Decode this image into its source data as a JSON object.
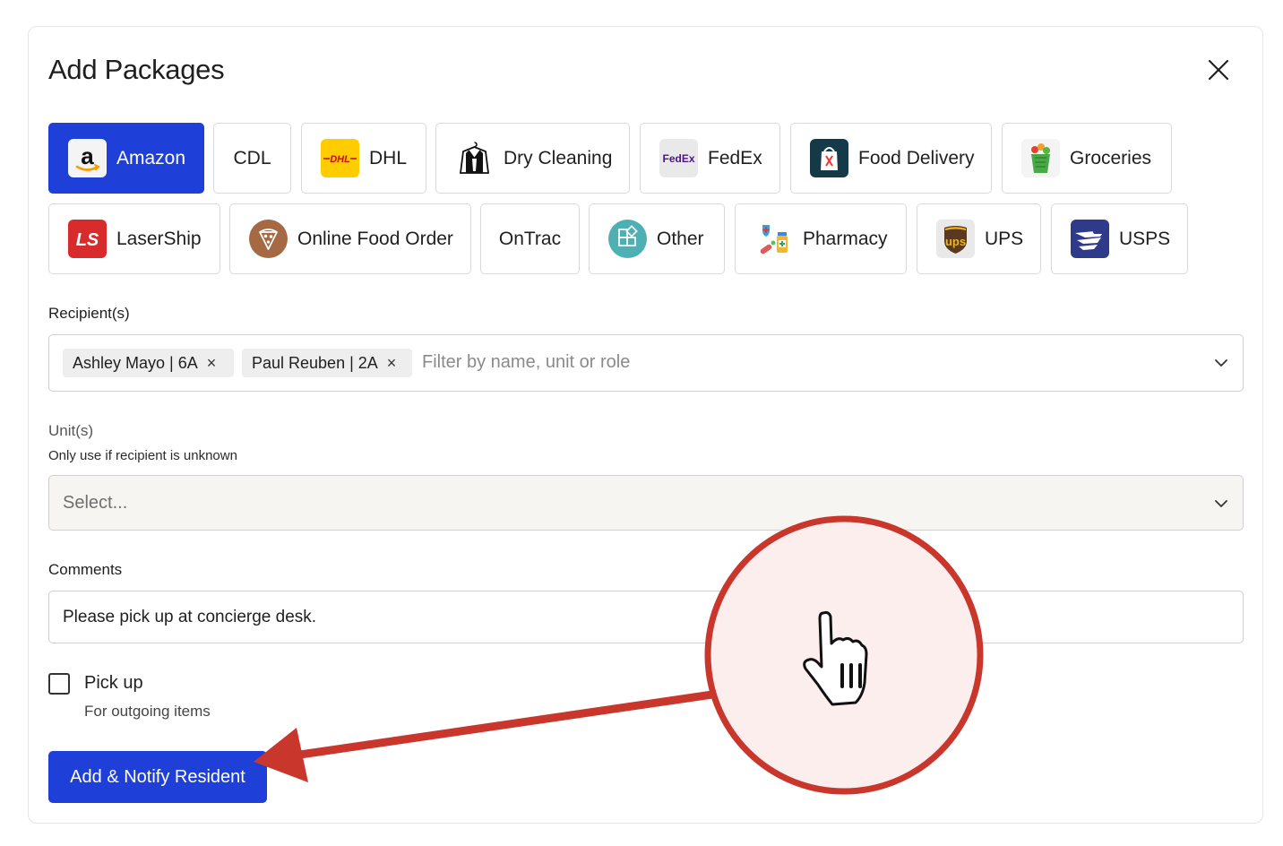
{
  "modal": {
    "title": "Add Packages"
  },
  "carriers": [
    {
      "label": "Amazon",
      "icon": "amazon-icon",
      "selected": true
    },
    {
      "label": "CDL",
      "icon": "",
      "selected": false
    },
    {
      "label": "DHL",
      "icon": "dhl-icon",
      "selected": false
    },
    {
      "label": "Dry Cleaning",
      "icon": "dry-cleaning-icon",
      "selected": false
    },
    {
      "label": "FedEx",
      "icon": "fedex-icon",
      "selected": false
    },
    {
      "label": "Food Delivery",
      "icon": "food-delivery-icon",
      "selected": false
    },
    {
      "label": "Groceries",
      "icon": "groceries-icon",
      "selected": false
    },
    {
      "label": "LaserShip",
      "icon": "lasership-icon",
      "selected": false
    },
    {
      "label": "Online Food Order",
      "icon": "pizza-icon",
      "selected": false
    },
    {
      "label": "OnTrac",
      "icon": "",
      "selected": false
    },
    {
      "label": "Other",
      "icon": "grid-icon",
      "selected": false
    },
    {
      "label": "Pharmacy",
      "icon": "pharmacy-icon",
      "selected": false
    },
    {
      "label": "UPS",
      "icon": "ups-icon",
      "selected": false
    },
    {
      "label": "USPS",
      "icon": "usps-eagle-icon",
      "selected": false
    }
  ],
  "logo_text": {
    "amazon": "a",
    "dhl": "DHL",
    "fedex": "FedEx",
    "ups": "ups",
    "lasership": "LS"
  },
  "recipients": {
    "label": "Recipient(s)",
    "chips": [
      {
        "text": "Ashley Mayo | 6A",
        "remove": "×"
      },
      {
        "text": "Paul Reuben | 2A",
        "remove": "×"
      }
    ],
    "placeholder": "Filter by name, unit or role"
  },
  "units": {
    "label": "Unit(s)",
    "hint": "Only use if recipient is unknown",
    "placeholder": "Select..."
  },
  "comments": {
    "label": "Comments",
    "value": "Please pick up at concierge desk."
  },
  "pickup": {
    "label": "Pick up",
    "hint": "For outgoing items",
    "checked": false
  },
  "submit": {
    "label": "Add & Notify Resident"
  },
  "colors": {
    "primary": "#1e40d8",
    "annotation_red": "#c9372c",
    "annotation_fill": "#fdeeee"
  }
}
